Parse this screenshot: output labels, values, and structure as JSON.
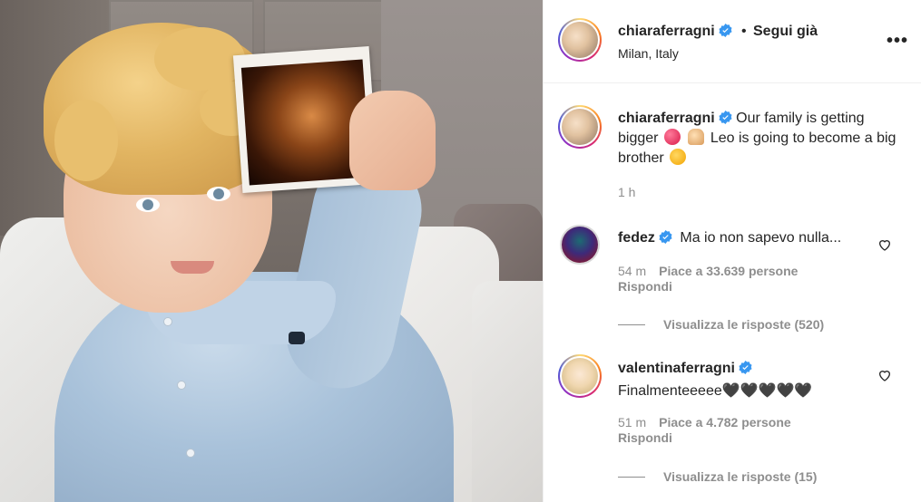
{
  "post": {
    "author": "chiaraferragni",
    "follow_separator": "•",
    "follow_label": "Segui già",
    "location": "Milan, Italy",
    "more_label": "•••",
    "caption_user": "chiaraferragni",
    "caption_part1": "Our family is getting bigger",
    "caption_part2": "Leo is going to become a big brother",
    "caption_emojis": [
      "heart-sparkle-emoji",
      "praying-hands-emoji",
      "star-eyes-emoji"
    ],
    "time": "1 h"
  },
  "comments": [
    {
      "user": "fedez",
      "text": "Ma io non sapevo nulla...",
      "time": "54 m",
      "likes": "Piace a 33.639 persone",
      "reply": "Rispondi",
      "view_replies": "Visualizza le risposte (520)"
    },
    {
      "user": "valentinaferragni",
      "text": "Finalmenteeeee🖤🖤🖤🖤🖤",
      "time": "51 m",
      "likes": "Piace a 4.782 persone",
      "reply": "Rispondi",
      "view_replies": "Visualizza le risposte (15)"
    }
  ],
  "colors": {
    "verified": "#3897f0",
    "muted": "#8e8e8e",
    "text": "#262626"
  }
}
